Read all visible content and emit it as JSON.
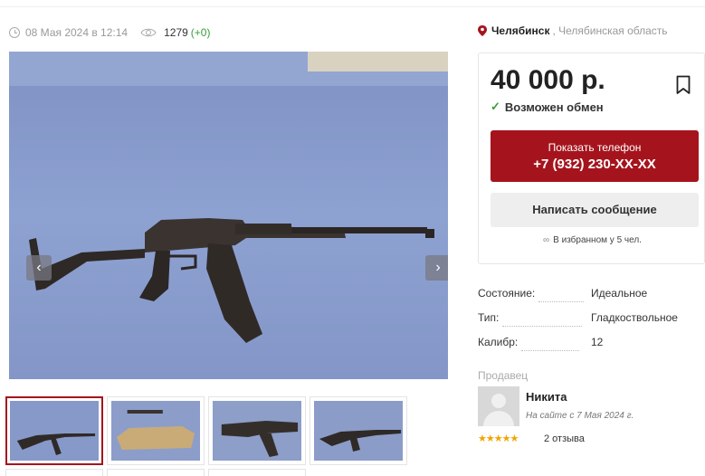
{
  "meta": {
    "posted": "08 Мая 2024 в 12:14",
    "views": "1279",
    "views_delta": "(+0)"
  },
  "gallery": {
    "prev_icon": "‹",
    "next_icon": "›",
    "fullscreen_icon": "fullscreen-icon",
    "thumb_count": 4
  },
  "location": {
    "city": "Челябинск",
    "region": ", Челябинская область"
  },
  "listing": {
    "price": "40 000 р.",
    "exchange": "Возможен обмен",
    "phone_label": "Показать телефон",
    "phone_number": "+7 (932) 230-XX-XX",
    "message_button": "Написать сообщение",
    "favorites": "В избранном у 5 чел."
  },
  "specs": [
    {
      "key": "Состояние:",
      "value": "Идеальное"
    },
    {
      "key": "Тип:",
      "value": "Гладкоствольное"
    },
    {
      "key": "Калибр:",
      "value": "12"
    }
  ],
  "seller": {
    "label": "Продавец",
    "name": "Никита",
    "since": "На сайте с 7 Мая 2024 г.",
    "rating": "★★★★★",
    "reviews": "2 отзыва"
  },
  "colors": {
    "accent": "#a5141d",
    "success": "#3a9c3a",
    "stars": "#f0a500"
  }
}
